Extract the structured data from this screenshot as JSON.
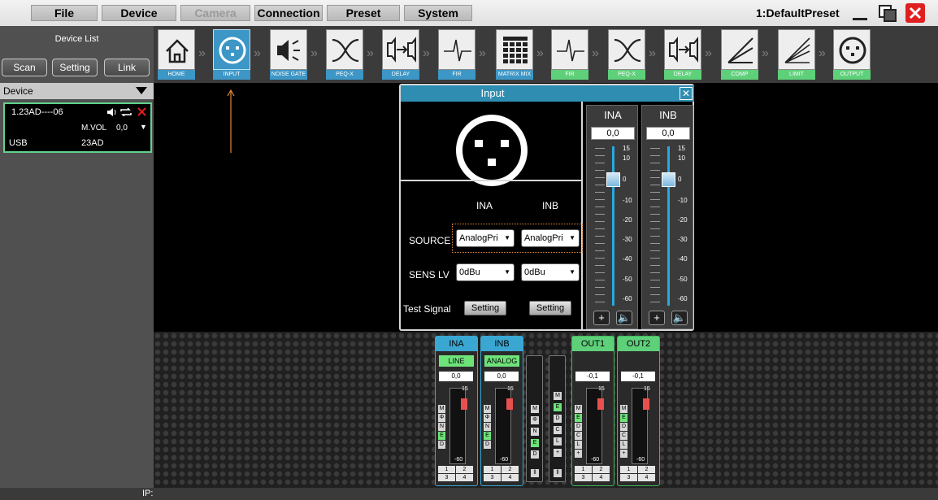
{
  "menu": {
    "file": "File",
    "device": "Device",
    "camera": "Camera",
    "connection": "Connection",
    "preset": "Preset",
    "system": "System"
  },
  "preset_name": "1:DefaultPreset",
  "left_panel": {
    "title": "Device List",
    "scan": "Scan",
    "setting": "Setting",
    "link": "Link",
    "device_header": "Device",
    "device": {
      "name": "1.23AD----06",
      "mvol_label": "M.VOL",
      "mvol_value": "0,0",
      "connection": "USB",
      "id": "23AD"
    }
  },
  "status": {
    "ip_label": "IP:"
  },
  "toolbar": [
    {
      "label": "HOME",
      "icon": "home-icon"
    },
    {
      "label": "INPUT",
      "icon": "xlr-input-icon"
    },
    {
      "label": "NOISE GATE",
      "icon": "speaker-gate-icon"
    },
    {
      "label": "PEQ-X",
      "icon": "crossover-icon"
    },
    {
      "label": "DELAY",
      "icon": "delay-icon"
    },
    {
      "label": "FIR",
      "icon": "fir-icon"
    },
    {
      "label": "MATRIX MIX",
      "icon": "matrix-icon"
    },
    {
      "label": "FIR",
      "icon": "fir-icon"
    },
    {
      "label": "PEQ-X",
      "icon": "crossover-icon"
    },
    {
      "label": "DELAY",
      "icon": "delay-icon"
    },
    {
      "label": "COMP",
      "icon": "compressor-icon"
    },
    {
      "label": "LIMIT",
      "icon": "limiter-icon"
    },
    {
      "label": "OUTPUT",
      "icon": "xlr-output-icon"
    }
  ],
  "dialog": {
    "title": "Input",
    "col_a": "INA",
    "col_b": "INB",
    "source_label": "SOURCE",
    "source_a": "AnalogPri",
    "source_b": "AnalogPri",
    "sens_label": "SENS LV",
    "sens_a": "0dBu",
    "sens_b": "0dBu",
    "test_label": "Test Signal",
    "setting": "Setting",
    "faders": [
      {
        "name": "INA",
        "value": "0,0"
      },
      {
        "name": "INB",
        "value": "0,0"
      }
    ],
    "scale": [
      "15",
      "10",
      "0",
      "-10",
      "-20",
      "-30",
      "-40",
      "-50",
      "-60"
    ]
  },
  "mixer": {
    "strips": [
      {
        "name": "INA",
        "tag": "LINE",
        "value": "0,0",
        "color": "#3aa7d2"
      },
      {
        "name": "INB",
        "tag": "ANALOG",
        "value": "0,0",
        "color": "#3aa7d2"
      },
      {
        "name": "OUT1",
        "tag": "",
        "value": "-0,1",
        "color": "#5fd07a"
      },
      {
        "name": "OUT2",
        "tag": "",
        "value": "-0,1",
        "color": "#5fd07a"
      }
    ],
    "scale_top": "15",
    "scale_bottom": "-60",
    "in_buttons": [
      "M",
      "Φ",
      "N",
      "E",
      "D"
    ],
    "out_buttons": [
      "M",
      "E",
      "D",
      "C",
      "L",
      "+"
    ],
    "nums": [
      "1",
      "2",
      "3",
      "4"
    ],
    "narrow_a": [
      "M",
      "Φ",
      "N",
      "E",
      "D"
    ],
    "narrow_b": [
      "M",
      "E",
      "D",
      "C",
      "L",
      "+"
    ]
  },
  "colors": {
    "accent": "#3c96c6",
    "green": "#5fd07a",
    "close_red": "#e02020"
  }
}
